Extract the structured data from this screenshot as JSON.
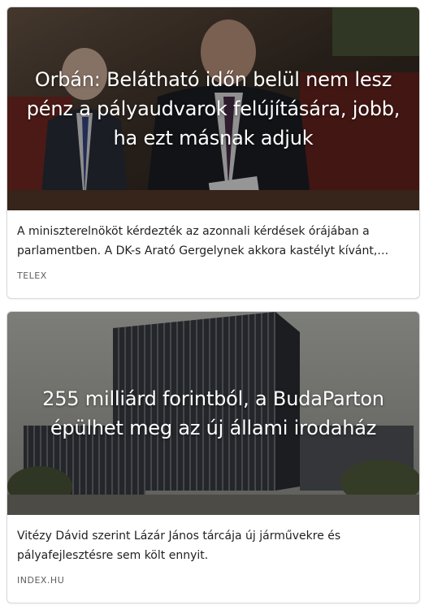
{
  "feed": {
    "articles": [
      {
        "headline": "Orbán: Belátható időn belül nem lesz pénz a pályaudvarok felújítására, jobb, ha ezt másnak adjuk",
        "excerpt": "A miniszterelnököt kérdezték az azonnali kérdések órájában a parlamentben. A DK-s Arató Gergelynek akkora kastélyt kívánt, amekkorát csak akar.",
        "source": "TELEX",
        "image_subject": "parliament-speaker-photo"
      },
      {
        "headline": "255 milliárd forintból, a BudaParton épülhet meg az új állami irodaház",
        "excerpt": "Vitézy Dávid szerint Lázár János tárcája új járművekre és pályafejlesztésre sem költ ennyit.",
        "source": "INDEX.HU",
        "image_subject": "office-building-rendering"
      }
    ]
  }
}
